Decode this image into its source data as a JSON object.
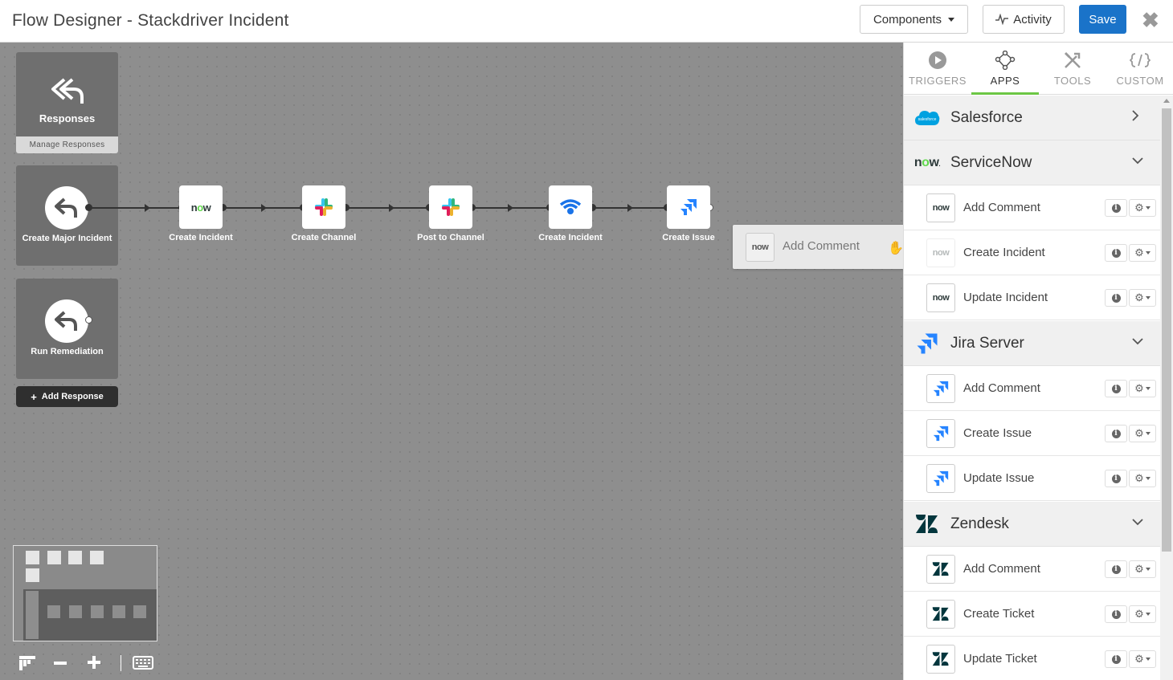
{
  "header": {
    "title": "Flow Designer - Stackdriver Incident",
    "components_label": "Components",
    "activity_label": "Activity",
    "save_label": "Save",
    "close_glyph": "✖"
  },
  "responses": {
    "title": "Responses",
    "manage_label": "Manage Responses",
    "items": [
      {
        "label": "Create Major Incident"
      },
      {
        "label": "Run Remediation"
      }
    ],
    "add_label": "Add Response"
  },
  "flow": {
    "nodes": [
      {
        "label": "Create Incident",
        "icon": "servicenow-icon"
      },
      {
        "label": "Create Channel",
        "icon": "slack-icon"
      },
      {
        "label": "Post to Channel",
        "icon": "slack-icon"
      },
      {
        "label": "Create Incident",
        "icon": "stackdriver-icon"
      },
      {
        "label": "Create Issue",
        "icon": "jira-icon"
      }
    ]
  },
  "drag": {
    "label": "Add Comment",
    "icon": "servicenow-icon"
  },
  "tabs": [
    {
      "label": "TRIGGERS",
      "icon": "play-icon"
    },
    {
      "label": "APPS",
      "icon": "apps-icon",
      "active": true
    },
    {
      "label": "TOOLS",
      "icon": "tools-icon"
    },
    {
      "label": "CUSTOM",
      "icon": "code-icon"
    }
  ],
  "apps": {
    "salesforce": {
      "name": "Salesforce",
      "logo_text": "salesforce"
    },
    "servicenow": {
      "name": "ServiceNow",
      "items": [
        "Add Comment",
        "Create Incident",
        "Update Incident"
      ]
    },
    "jira": {
      "name": "Jira Server",
      "items": [
        "Add Comment",
        "Create Issue",
        "Update Issue"
      ]
    },
    "zendesk": {
      "name": "Zendesk",
      "items": [
        "Add Comment",
        "Create Ticket",
        "Update Ticket"
      ]
    }
  },
  "colors": {
    "save": "#1a73c9",
    "active_tab": "#6cc644",
    "canvas": "#8e8e8e",
    "jira": "#2684ff",
    "stackdriver": "#1a73e8"
  }
}
